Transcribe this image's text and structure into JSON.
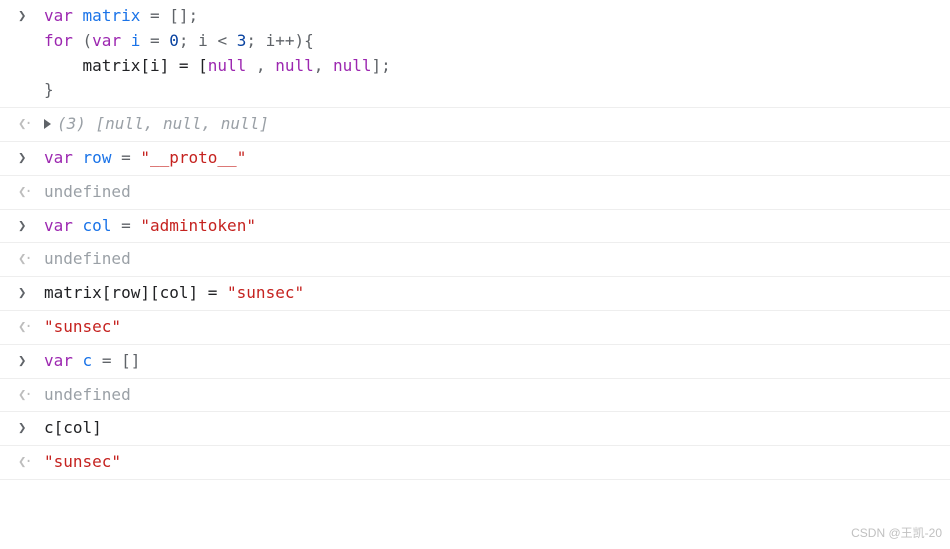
{
  "entries": [
    {
      "type": "input",
      "code": [
        {
          "indent": 0,
          "tokens": [
            {
              "cls": "kw",
              "t": "var"
            },
            {
              "cls": "op",
              "t": " "
            },
            {
              "cls": "ident",
              "t": "matrix"
            },
            {
              "cls": "op",
              "t": " = [];"
            }
          ]
        },
        {
          "indent": 0,
          "tokens": [
            {
              "cls": "kw",
              "t": "for"
            },
            {
              "cls": "op",
              "t": " ("
            },
            {
              "cls": "kw",
              "t": "var"
            },
            {
              "cls": "op",
              "t": " "
            },
            {
              "cls": "ident",
              "t": "i"
            },
            {
              "cls": "op",
              "t": " = "
            },
            {
              "cls": "num",
              "t": "0"
            },
            {
              "cls": "op",
              "t": "; i < "
            },
            {
              "cls": "num",
              "t": "3"
            },
            {
              "cls": "op",
              "t": "; i++){"
            }
          ]
        },
        {
          "indent": 1,
          "tokens": [
            {
              "cls": "txt",
              "t": "matrix[i] = ["
            },
            {
              "cls": "kw",
              "t": "null"
            },
            {
              "cls": "op",
              "t": " , "
            },
            {
              "cls": "kw",
              "t": "null"
            },
            {
              "cls": "op",
              "t": ", "
            },
            {
              "cls": "kw",
              "t": "null"
            },
            {
              "cls": "op",
              "t": "];"
            }
          ]
        },
        {
          "indent": 0,
          "tokens": [
            {
              "cls": "op",
              "t": "}"
            }
          ]
        }
      ]
    },
    {
      "type": "output-array",
      "summary": "(3) [null, null, null]"
    },
    {
      "type": "input",
      "code": [
        {
          "indent": 0,
          "tokens": [
            {
              "cls": "kw",
              "t": "var"
            },
            {
              "cls": "op",
              "t": " "
            },
            {
              "cls": "ident",
              "t": "row"
            },
            {
              "cls": "op",
              "t": " = "
            },
            {
              "cls": "str",
              "t": "\"__proto__\""
            }
          ]
        }
      ]
    },
    {
      "type": "output-text",
      "value": "undefined",
      "style": "undef"
    },
    {
      "type": "input",
      "code": [
        {
          "indent": 0,
          "tokens": [
            {
              "cls": "kw",
              "t": "var"
            },
            {
              "cls": "op",
              "t": " "
            },
            {
              "cls": "ident",
              "t": "col"
            },
            {
              "cls": "op",
              "t": " = "
            },
            {
              "cls": "str",
              "t": "\"admintoken\""
            }
          ]
        }
      ]
    },
    {
      "type": "output-text",
      "value": "undefined",
      "style": "undef"
    },
    {
      "type": "input",
      "code": [
        {
          "indent": 0,
          "tokens": [
            {
              "cls": "txt",
              "t": "matrix[row][col] = "
            },
            {
              "cls": "str",
              "t": "\"sunsec\""
            }
          ]
        }
      ]
    },
    {
      "type": "output-text",
      "value": "\"sunsec\"",
      "style": "str"
    },
    {
      "type": "input",
      "code": [
        {
          "indent": 0,
          "tokens": [
            {
              "cls": "kw",
              "t": "var"
            },
            {
              "cls": "op",
              "t": " "
            },
            {
              "cls": "ident",
              "t": "c"
            },
            {
              "cls": "op",
              "t": " = []"
            }
          ]
        }
      ]
    },
    {
      "type": "output-text",
      "value": "undefined",
      "style": "undef"
    },
    {
      "type": "input",
      "code": [
        {
          "indent": 0,
          "tokens": [
            {
              "cls": "txt",
              "t": "c[col]"
            }
          ]
        }
      ]
    },
    {
      "type": "output-text",
      "value": "\"sunsec\"",
      "style": "str"
    }
  ],
  "watermark": "CSDN @王凯-20"
}
